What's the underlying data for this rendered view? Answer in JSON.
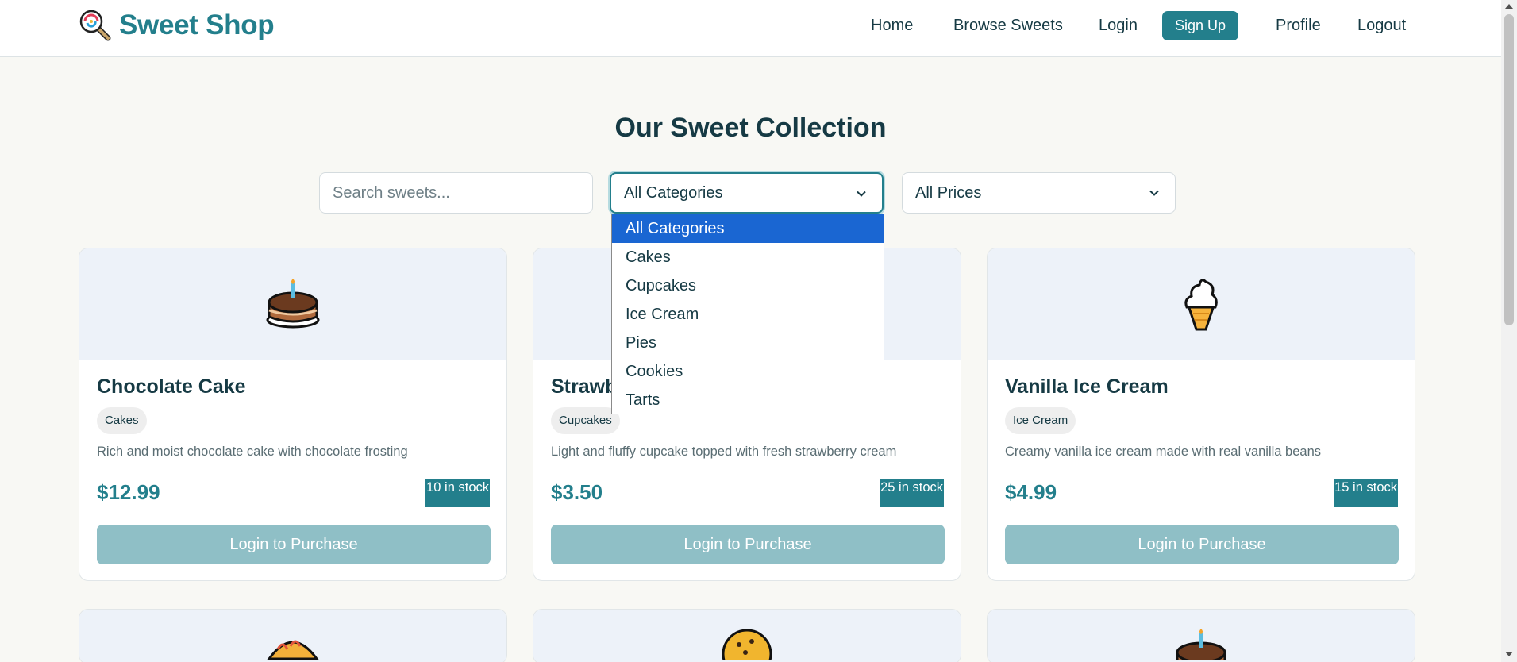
{
  "brand": {
    "name": "Sweet Shop"
  },
  "nav": {
    "items": [
      "Home",
      "Browse Sweets",
      "Login"
    ],
    "signup": "Sign Up",
    "profile": "Profile",
    "logout": "Logout"
  },
  "page_title": "Our Sweet Collection",
  "filters": {
    "search_placeholder": "Search sweets...",
    "category_selected": "All Categories",
    "price_selected": "All Prices"
  },
  "category_options": [
    "All Categories",
    "Cakes",
    "Cupcakes",
    "Ice Cream",
    "Pies",
    "Cookies",
    "Tarts"
  ],
  "products": [
    {
      "name": "Chocolate Cake",
      "category": "Cakes",
      "description": "Rich and moist chocolate cake with chocolate frosting",
      "price": "$12.99",
      "stock": "10 in stock",
      "button": "Login to Purchase",
      "icon": "cake-icon"
    },
    {
      "name": "Strawb",
      "category": "Cupcakes",
      "description": "Light and fluffy cupcake topped with fresh strawberry cream",
      "price": "$3.50",
      "stock": "25 in stock",
      "button": "Login to Purchase",
      "icon": "cupcake-icon"
    },
    {
      "name": "Vanilla Ice Cream",
      "category": "Ice Cream",
      "description": "Creamy vanilla ice cream made with real vanilla beans",
      "price": "$4.99",
      "stock": "15 in stock",
      "button": "Login to Purchase",
      "icon": "ice-cream-icon"
    }
  ],
  "peek_icons": [
    "pie-icon",
    "cookie-icon",
    "cake-icon"
  ],
  "colors": {
    "accent": "#237f8c",
    "selected_option": "#1a66d2",
    "disabled_button": "#8fbfc6"
  }
}
